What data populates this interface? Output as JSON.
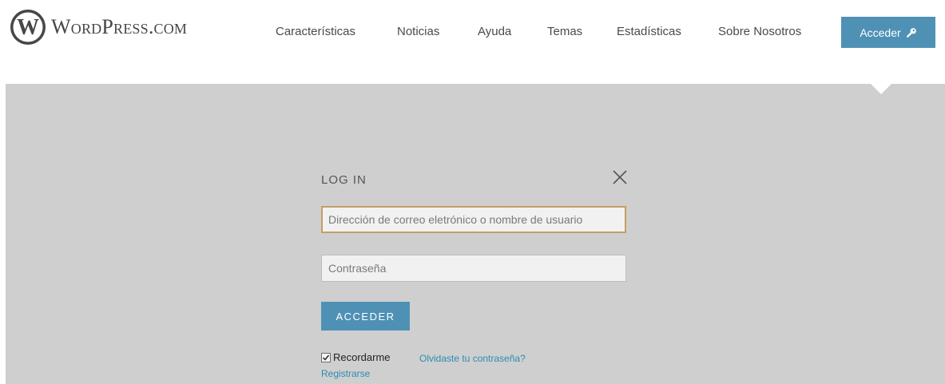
{
  "header": {
    "logo_text": "WordPress.com",
    "nav": [
      {
        "label": "Características"
      },
      {
        "label": "Noticias"
      },
      {
        "label": "Ayuda"
      },
      {
        "label": "Temas"
      },
      {
        "label": "Estadísticas"
      },
      {
        "label": "Sobre Nosotros"
      }
    ],
    "login_button_label": "Acceder",
    "login_button_icon": "key-icon"
  },
  "login_form": {
    "title": "LOG IN",
    "close_icon": "close-icon",
    "email_placeholder": "Dirección de correo eletrónico o nombre de usuario",
    "email_value": "",
    "password_placeholder": "Contraseña",
    "password_value": "",
    "submit_label": "ACCEDER",
    "remember_label": "Recordarme",
    "remember_checked": true,
    "forgot_link": "Olvidaste tu contraseña?",
    "register_link": "Registrarse"
  },
  "colors": {
    "accent": "#4f91b5",
    "overlay": "#cfcfcf",
    "link": "#2e8bb3",
    "focus_border": "#c99c63"
  }
}
